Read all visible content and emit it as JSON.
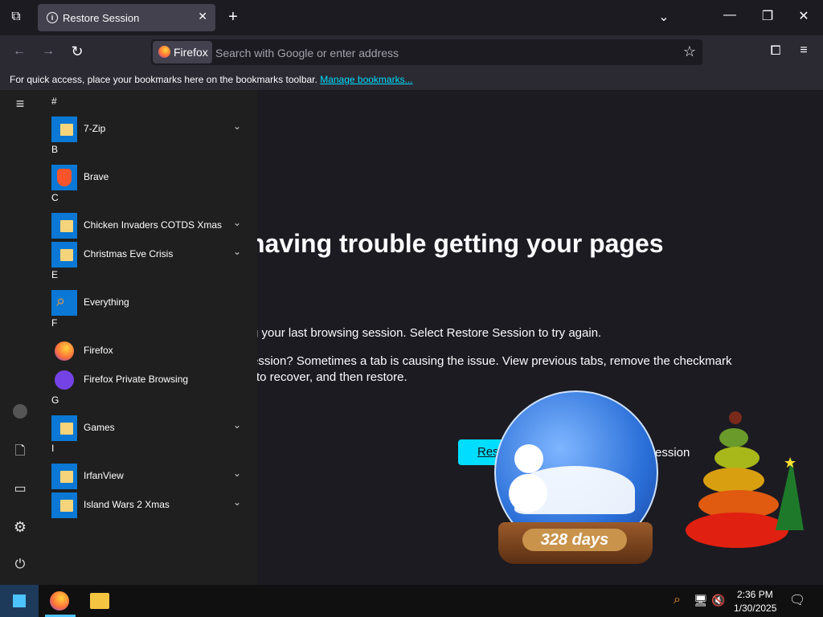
{
  "browser": {
    "tab_title": "Restore Session",
    "tab_info_glyph": "i",
    "url_badge": "Firefox",
    "url_placeholder": "Search with Google or enter address",
    "bookmarks_text": "For quick access, place your bookmarks here on the bookmarks toolbar.",
    "bookmarks_link": "Manage bookmarks..."
  },
  "page": {
    "heading": "having trouble getting your pages",
    "line1": "g your last browsing session. Select Restore Session to try again.",
    "line2": "ession? Sometimes a tab is causing the issue. View previous tabs, remove the checkmark",
    "line3": "to recover, and then restore.",
    "restore_button": "Res",
    "new_session": "w Session"
  },
  "start_menu": {
    "sections": [
      {
        "letter": "#",
        "apps": [
          {
            "name": "7-Zip",
            "icon": "folder-icon",
            "expandable": true
          }
        ]
      },
      {
        "letter": "B",
        "apps": [
          {
            "name": "Brave",
            "icon": "brave-icon",
            "expandable": false
          }
        ]
      },
      {
        "letter": "C",
        "apps": [
          {
            "name": "Chicken Invaders COTDS Xmas",
            "icon": "folder-icon",
            "expandable": true
          },
          {
            "name": "Christmas Eve Crisis",
            "icon": "folder-icon",
            "expandable": true
          }
        ]
      },
      {
        "letter": "E",
        "apps": [
          {
            "name": "Everything",
            "icon": "search-magnifier-icon",
            "expandable": false
          }
        ]
      },
      {
        "letter": "F",
        "apps": [
          {
            "name": "Firefox",
            "icon": "firefox-icon",
            "expandable": false
          },
          {
            "name": "Firefox Private Browsing",
            "icon": "firefox-private-icon",
            "expandable": false
          }
        ]
      },
      {
        "letter": "G",
        "apps": [
          {
            "name": "Games",
            "icon": "folder-icon",
            "expandable": true
          }
        ]
      },
      {
        "letter": "I",
        "apps": [
          {
            "name": "IrfanView",
            "icon": "folder-icon",
            "expandable": true
          },
          {
            "name": "Island Wars 2 Xmas",
            "icon": "folder-icon",
            "expandable": true
          }
        ]
      }
    ]
  },
  "overlay": {
    "globe_counter": "328 days"
  },
  "taskbar": {
    "time": "2:36 PM",
    "date": "1/30/2025"
  },
  "colors": {
    "accent": "#00ddff",
    "tile_blue": "#0a78d4",
    "page_bg": "#1c1b22"
  }
}
